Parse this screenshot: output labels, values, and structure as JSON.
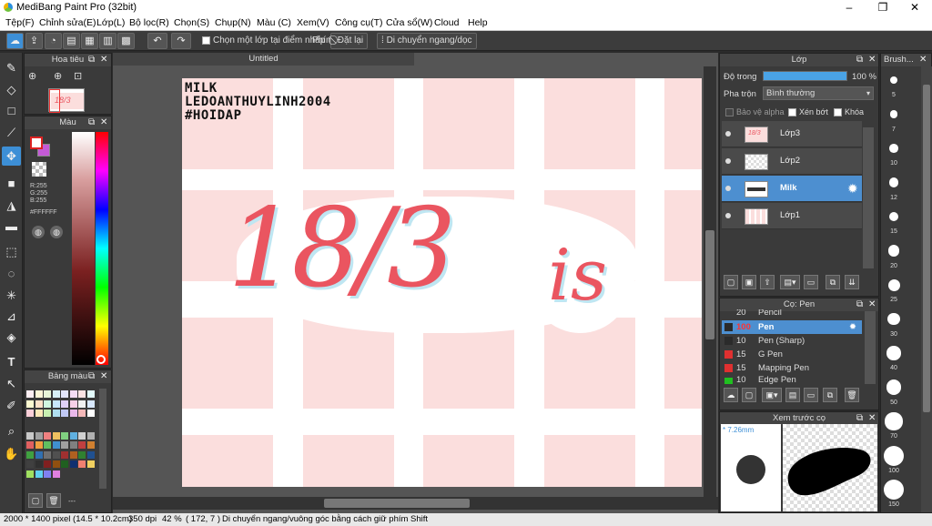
{
  "window": {
    "title": "MediBang Paint Pro (32bit)",
    "min": "–",
    "max": "❐",
    "close": "✕"
  },
  "menu": [
    "Tệp(F)",
    "Chỉnh sửa(E)",
    "Lớp(L)",
    "Bộ lọc(R)",
    "Chọn(S)",
    "Chụp(N)",
    "Màu (C)",
    "Xem(V)",
    "Công cụ(T)",
    "Cửa sổ(W)",
    "Cloud",
    "Help"
  ],
  "toolbar": {
    "icons": [
      "cloud-icon",
      "share-icon",
      "comment-icon",
      "message-icon",
      "document-icon",
      "grid-icon",
      "layout-icon"
    ],
    "select_layer_label": "Chọn một lớp tại điểm nhấp",
    "keys_label": "Phím",
    "reset_label": "Đặt lại",
    "move_label": "Di chuyển ngang/dọc"
  },
  "navigator": {
    "title": "Hoa tiêu"
  },
  "color": {
    "title": "Màu",
    "r": "R:255",
    "g": "G:255",
    "b": "B:255",
    "hex": "#FFFFFF",
    "primary": "#ffffff",
    "secondary": "#c45ad6"
  },
  "palette": {
    "title": "Bảng màu",
    "footer": "---"
  },
  "canvas": {
    "tab": "Untitled",
    "lines": [
      "MILK",
      "LEDOANTHUYLINH2004",
      "#HOIDAP"
    ],
    "big": "18/3",
    "small": "is"
  },
  "layers": {
    "title": "Lớp",
    "opacity_label": "Độ trong",
    "opacity_value": "100 %",
    "opacity_fraction": 1.0,
    "blend_label": "Pha trộn",
    "blend_value": "Bình thường",
    "protect_alpha": "Bảo vệ alpha",
    "clipping": "Xén bớt",
    "lock": "Khóa",
    "items": [
      {
        "name": "Lớp3",
        "selected": false
      },
      {
        "name": "Lớp2",
        "selected": false
      },
      {
        "name": "Milk",
        "selected": true
      },
      {
        "name": "Lớp1",
        "selected": false
      }
    ]
  },
  "brush": {
    "title": "Cọ: Pen",
    "items": [
      {
        "size": "20",
        "name": "Pencil",
        "color": "#3a3a3a"
      },
      {
        "size": "100",
        "name": "Pen",
        "color": "#2b2b2b",
        "selected": true
      },
      {
        "size": "10",
        "name": "Pen (Sharp)",
        "color": "#2b2b2b"
      },
      {
        "size": "15",
        "name": "G Pen",
        "color": "#e03030"
      },
      {
        "size": "15",
        "name": "Mapping Pen",
        "color": "#e03030"
      },
      {
        "size": "10",
        "name": "Edge Pen",
        "color": "#20c020"
      }
    ]
  },
  "preview": {
    "title": "Xem trước cọ",
    "size": "* 7.26mm"
  },
  "brush_sizes": {
    "title": "Brush...",
    "sizes": [
      "5",
      "7",
      "10",
      "12",
      "15",
      "20",
      "25",
      "30",
      "40",
      "50",
      "70",
      "100",
      "150"
    ]
  },
  "status": {
    "size": "2000 * 1400 pixel  (14.5 * 10.2cm)",
    "dpi": "350 dpi",
    "zoom": "42 %",
    "coords": "( 172, 7 )",
    "hint": "Di chuyển ngang/vuông góc bằng cách giữ phím Shift"
  }
}
